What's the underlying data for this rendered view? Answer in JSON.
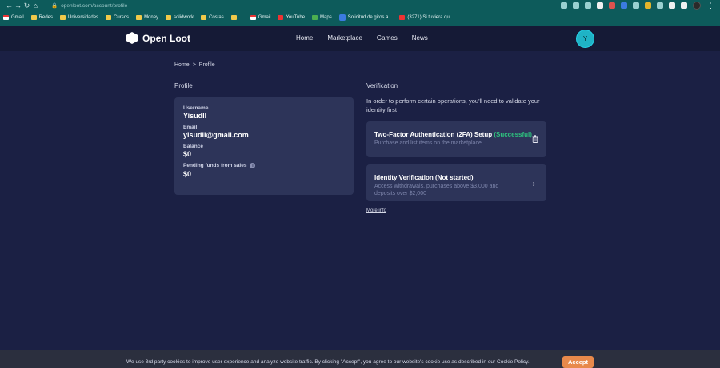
{
  "browser": {
    "url": "openloot.com/account/profile",
    "bookmarks": [
      {
        "label": "Gmail",
        "icon": "gmail-icon"
      },
      {
        "label": "Redes",
        "icon": "folder-icon"
      },
      {
        "label": "Universidades",
        "icon": "folder-icon"
      },
      {
        "label": "Cursos",
        "icon": "folder-icon"
      },
      {
        "label": "Money",
        "icon": "folder-icon"
      },
      {
        "label": "solidwork",
        "icon": "folder-icon"
      },
      {
        "label": "Costas",
        "icon": "folder-icon"
      },
      {
        "label": "...",
        "icon": "folder-icon"
      },
      {
        "label": "Gmail",
        "icon": "gmail-icon"
      },
      {
        "label": "YouTube",
        "icon": "youtube-icon"
      },
      {
        "label": "Maps",
        "icon": "maps-icon"
      },
      {
        "label": "Solicitud de giros a...",
        "icon": "site-icon"
      },
      {
        "label": "(3271) Si tuviera qu...",
        "icon": "youtube-icon"
      }
    ]
  },
  "header": {
    "logo_text": "Open Loot",
    "nav": [
      "Home",
      "Marketplace",
      "Games",
      "News"
    ],
    "avatar_letter": "Y"
  },
  "breadcrumb": {
    "home": "Home",
    "separator": ">",
    "current": "Profile"
  },
  "profile": {
    "title": "Profile",
    "username_label": "Username",
    "username": "Yisudll",
    "email_label": "Email",
    "email": "yisudll@gmail.com",
    "balance_label": "Balance",
    "balance": "$0",
    "pending_label": "Pending funds from sales",
    "pending": "$0"
  },
  "verification": {
    "title": "Verification",
    "description": "In order to perform certain operations, you'll need to validate your identity first",
    "twofa_title": "Two-Factor Authentication (2FA) Setup",
    "twofa_status": "(Successful)",
    "twofa_sub": "Purchase and list items on the marketplace",
    "identity_title": "Identity Verification (Not started)",
    "identity_sub": "Access withdrawals, purchases above $3,000 and deposits over $2,000",
    "more_info": "More info"
  },
  "cookie": {
    "text": "We use 3rd party cookies to improve user experience and analyze website traffic. By clicking \"Accept\", you agree to our website's cookie use as described in our Cookie Policy.",
    "accept": "Accept"
  },
  "colors": {
    "page_bg": "#1b2044",
    "card_bg": "#2d3459",
    "success": "#2ec27e",
    "accent_button": "#e8894b",
    "avatar": "#1fb3c6"
  }
}
